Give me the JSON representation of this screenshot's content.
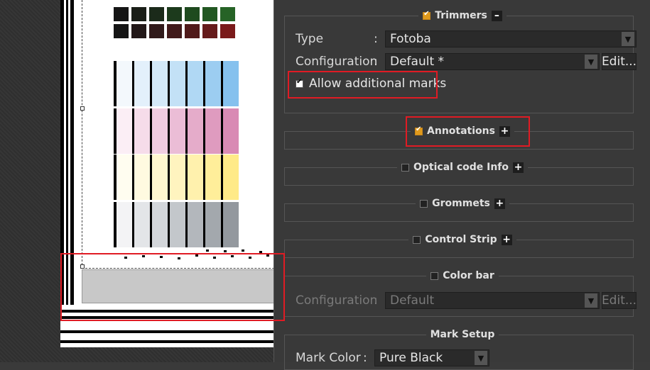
{
  "trimmers": {
    "title": "Trimmers",
    "toggle": "–",
    "type_label": "Type",
    "type_value": "Fotoba",
    "config_label": "Configuration",
    "config_value": "Default *",
    "edit_label": "Edit...",
    "allow_label": "Allow additional marks",
    "colon": ":"
  },
  "annotations": {
    "title": "Annotations",
    "toggle": "+"
  },
  "optical": {
    "title": "Optical code Info",
    "toggle": "+"
  },
  "grommets": {
    "title": "Grommets",
    "toggle": "+"
  },
  "control_strip": {
    "title": "Control Strip",
    "toggle": "+"
  },
  "color_bar": {
    "title": "Color bar",
    "config_label": "Configuration",
    "config_value": "Default",
    "edit_label": "Edit...",
    "colon": ":"
  },
  "mark_setup": {
    "title": "Mark Setup",
    "color_label": "Mark Color",
    "color_value": "Pure Black",
    "colon": ":"
  },
  "colors": {
    "highlight": "#e01b24",
    "accent": "#e09a1c"
  }
}
